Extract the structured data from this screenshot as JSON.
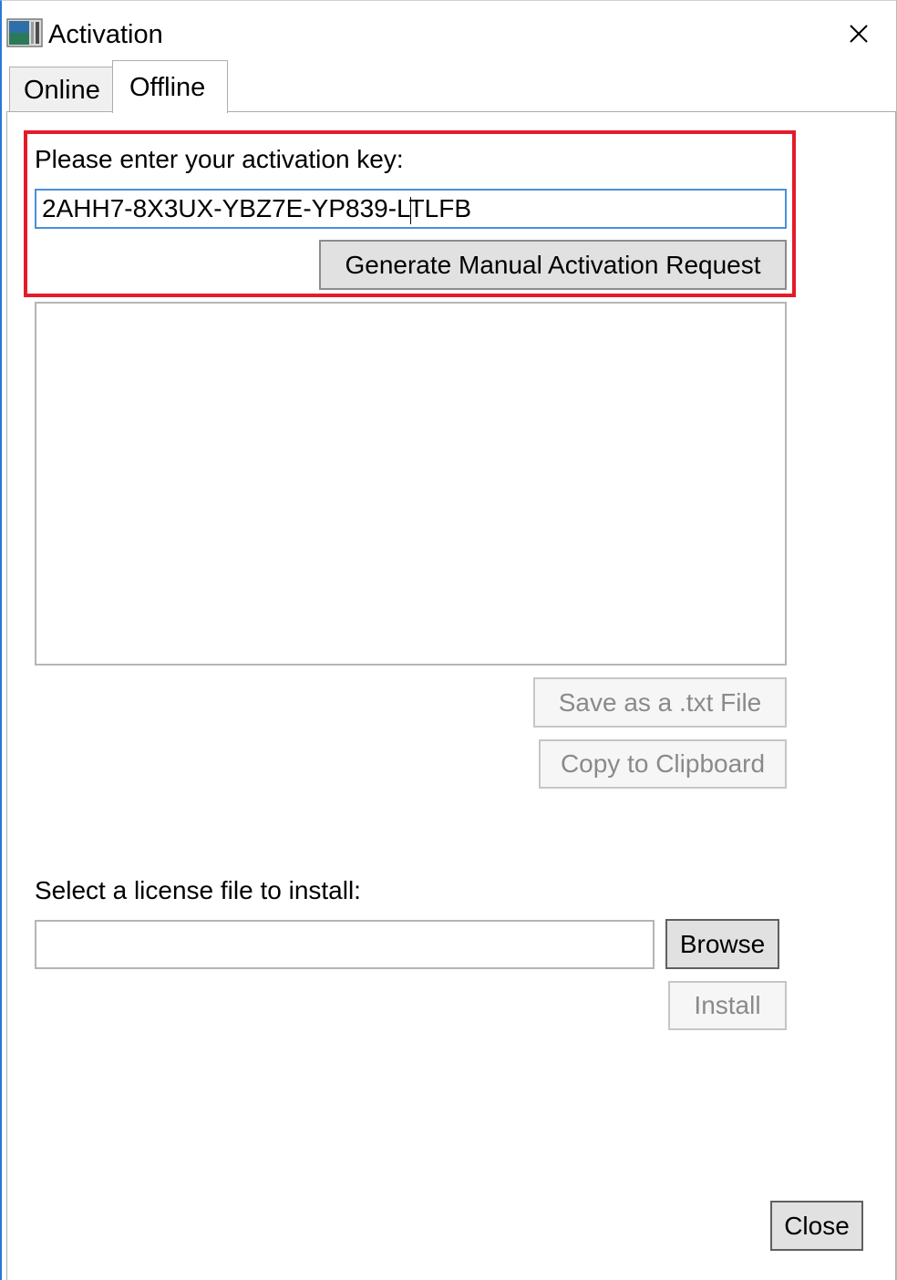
{
  "window": {
    "title": "Activation",
    "icon": "app-icon",
    "close_icon": "close-icon"
  },
  "tabs": [
    {
      "label": "Online",
      "selected": false
    },
    {
      "label": "Offline",
      "selected": true
    }
  ],
  "activation": {
    "key_label": "Please enter your activation key:",
    "key_value": "2AHH7-8X3UX-YBZ7E-YP839-LTLFB",
    "generate_button": "Generate Manual Activation Request"
  },
  "request": {
    "text": "",
    "save_button": "Save as a .txt File",
    "copy_button": "Copy to Clipboard"
  },
  "license": {
    "label": "Select a license file to install:",
    "file_value": "",
    "browse_button": "Browse",
    "install_button": "Install"
  },
  "footer": {
    "close_button": "Close"
  },
  "colors": {
    "highlight": "#e41b2a",
    "focus_border": "#4a90d9",
    "window_accent": "#2b78d6"
  }
}
